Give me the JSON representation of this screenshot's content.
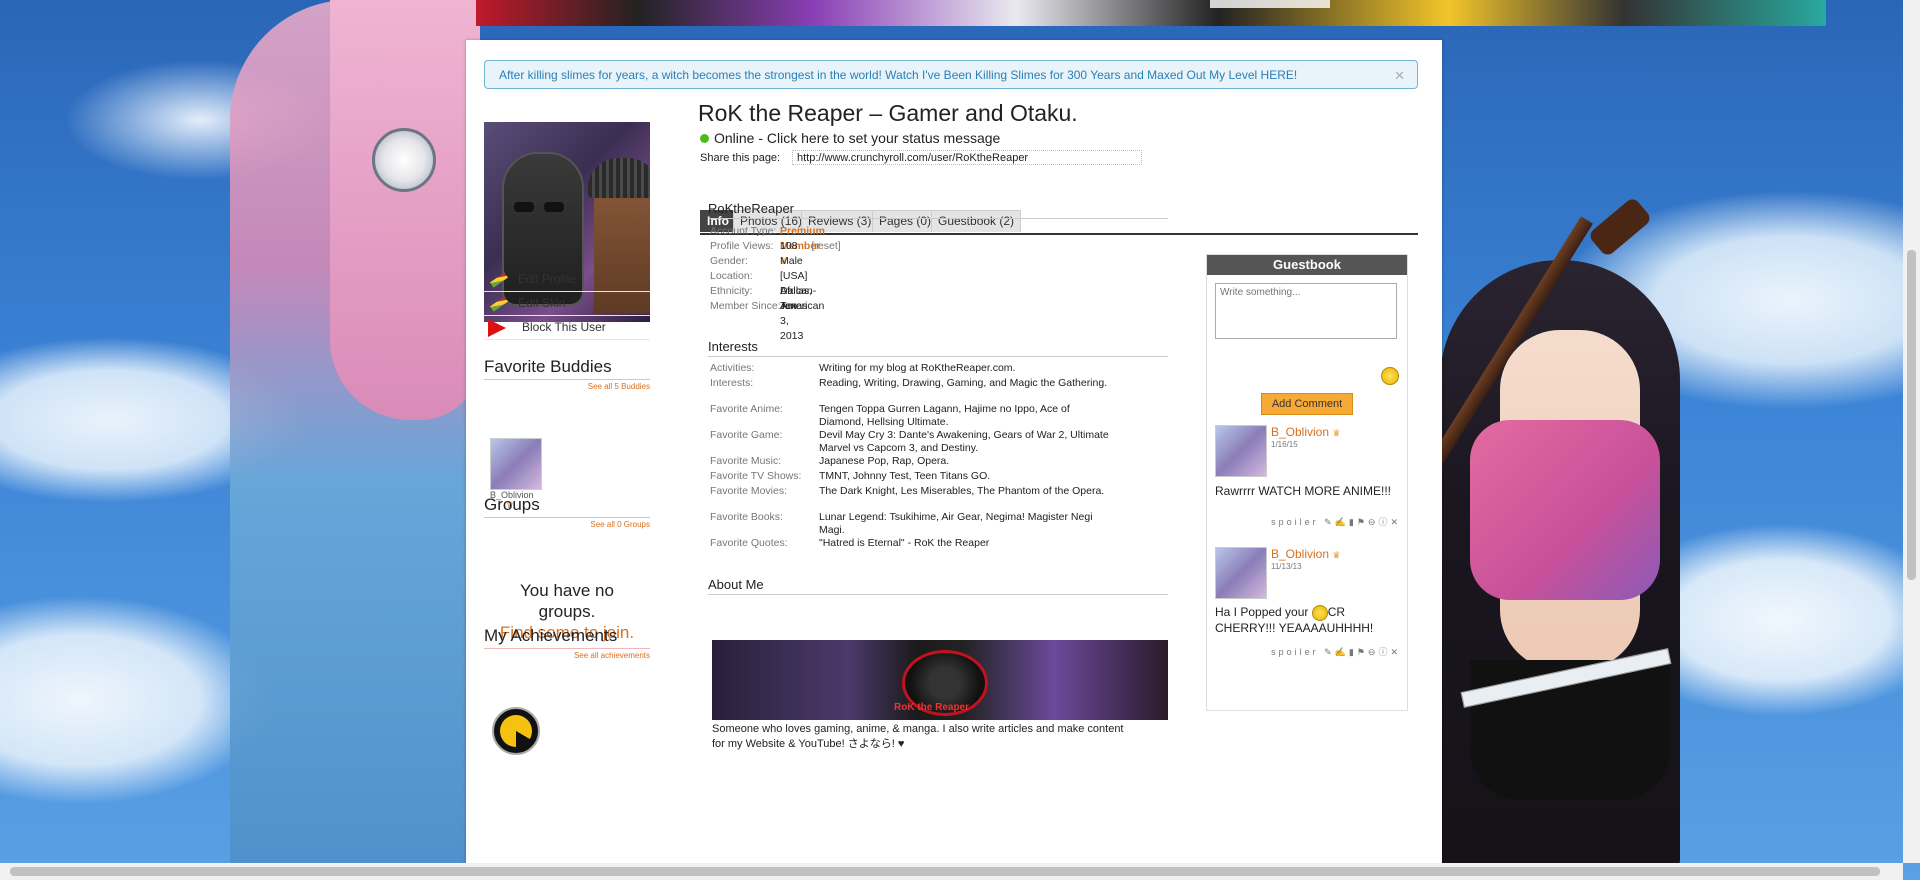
{
  "notice": {
    "text": "After killing slimes for years, a witch becomes the strongest in the world! Watch I've Been Killing Slimes for 300 Years and Maxed Out My Level HERE!",
    "close": "✕"
  },
  "sidebar": {
    "links": [
      {
        "label": "Edit Profile",
        "icon": "pencil-icon"
      },
      {
        "label": "Edit Skin",
        "icon": "pencil-icon"
      },
      {
        "label": "Block This User",
        "icon": "block-icon"
      }
    ],
    "buddies": {
      "title": "Favorite Buddies",
      "see_all": "See all 5 Buddies",
      "buddy_name": "B_Oblivion"
    },
    "groups": {
      "title": "Groups",
      "see_all": "See all 0 Groups",
      "msg_line1": "You have no",
      "msg_line2": "groups.",
      "link": "Find some to join."
    },
    "achievements": {
      "title": "My Achievements",
      "see_all": "See all achievements"
    }
  },
  "profile": {
    "title": "RoK the Reaper – Gamer and Otaku.",
    "status": "Online - Click here to set your status message",
    "share_label": "Share this page:",
    "share_url": "http://www.crunchyroll.com/user/RoKtheReaper"
  },
  "tabs": [
    {
      "label": "Info",
      "active": true
    },
    {
      "label": "Photos (16)"
    },
    {
      "label": "Reviews (3)"
    },
    {
      "label": "Pages (0)"
    },
    {
      "label": "Guestbook (2)"
    }
  ],
  "info": {
    "username": "RoKtheReaper",
    "rows": [
      {
        "k": "Account Type:",
        "v": "Premium Member"
      },
      {
        "k": "Profile Views:",
        "v": "108",
        "extra": "[reset]"
      },
      {
        "k": "Gender:",
        "v": "Male"
      },
      {
        "k": "Location:",
        "v": "[USA] Dallas, Texas"
      },
      {
        "k": "Ethnicity:",
        "v": "African-American"
      },
      {
        "k": "Member Since:",
        "v": "Jun 3, 2013"
      }
    ]
  },
  "interests": {
    "title": "Interests",
    "rows": [
      {
        "k": "Activities:",
        "v": "Writing for my blog at RoKtheReaper.com."
      },
      {
        "k": "Interests:",
        "v": "Reading, Writing, Drawing, Gaming, and Magic the Gathering."
      },
      {
        "k": "Favorite Anime:",
        "v": "Tengen Toppa Gurren Lagann, Hajime no Ippo, Ace of Diamond, Hellsing Ultimate."
      },
      {
        "k": "Favorite Game:",
        "v": "Devil May Cry 3: Dante's Awakening, Gears of War 2, Ultimate Marvel vs Capcom 3, and Destiny."
      },
      {
        "k": "Favorite Music:",
        "v": "Japanese Pop, Rap, Opera."
      },
      {
        "k": "Favorite TV Shows:",
        "v": "TMNT, Johnny Test, Teen Titans GO."
      },
      {
        "k": "Favorite Movies:",
        "v": "The Dark Knight, Les Miserables, The Phantom of the Opera."
      },
      {
        "k": "Favorite Books:",
        "v": "Lunar Legend: Tsukihime, Air Gear, Negima! Magister Negi Magi."
      },
      {
        "k": "Favorite Quotes:",
        "v": "\"Hatred is Eternal\" - RoK the Reaper"
      }
    ]
  },
  "about": {
    "title": "About Me",
    "logo_text": "RoK the Reaper",
    "text": "Someone who loves gaming, anime, & manga. I also write articles and make content for my Website & YouTube! さよなら! ♥"
  },
  "guestbook": {
    "title": "Guestbook",
    "placeholder": "Write something...",
    "add_label": "Add Comment",
    "entries": [
      {
        "name": "B_Oblivion",
        "date": "1/16/15",
        "text": "Rawrrrr WATCH MORE ANIME!!!",
        "spoiler": "spoiler"
      },
      {
        "name": "B_Oblivion",
        "date": "11/13/13",
        "text_pre": "Ha I Popped your ",
        "text_post": "CR CHERRY!!! YEAAAAUHHHH!",
        "spoiler": "spoiler"
      }
    ]
  },
  "colors": {
    "accent": "#d8701e",
    "online": "#4cbb17",
    "notice_border": "#70b5d9"
  }
}
